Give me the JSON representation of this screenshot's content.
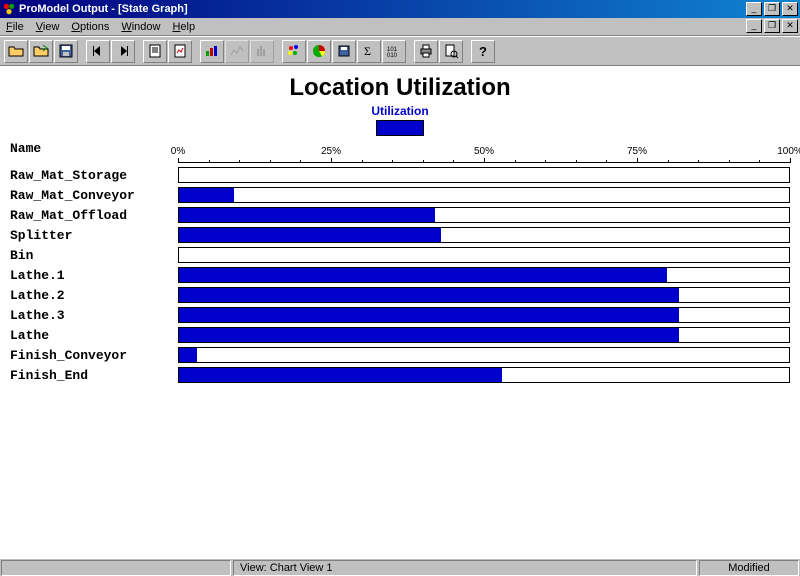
{
  "window": {
    "title": "ProModel Output - [State Graph]"
  },
  "menu": {
    "file": "File",
    "view": "View",
    "options": "Options",
    "window": "Window",
    "help": "Help"
  },
  "statusbar": {
    "view_label": "View:  Chart View 1",
    "modified": "Modified"
  },
  "chart_data": {
    "type": "bar",
    "title": "Location Utilization",
    "legend_label": "Utilization",
    "name_header": "Name",
    "xlabel": "",
    "ylabel": "",
    "xlim": [
      0,
      100
    ],
    "ticks": [
      {
        "pos": 0,
        "label": "0%"
      },
      {
        "pos": 25,
        "label": "25%"
      },
      {
        "pos": 50,
        "label": "50%"
      },
      {
        "pos": 75,
        "label": "75%"
      },
      {
        "pos": 100,
        "label": "100%"
      }
    ],
    "categories": [
      "Raw_Mat_Storage",
      "Raw_Mat_Conveyor",
      "Raw_Mat_Offload",
      "Splitter",
      "Bin",
      "Lathe.1",
      "Lathe.2",
      "Lathe.3",
      "Lathe",
      "Finish_Conveyor",
      "Finish_End"
    ],
    "values": [
      0,
      9,
      42,
      43,
      0,
      80,
      82,
      82,
      82,
      3,
      53
    ]
  }
}
